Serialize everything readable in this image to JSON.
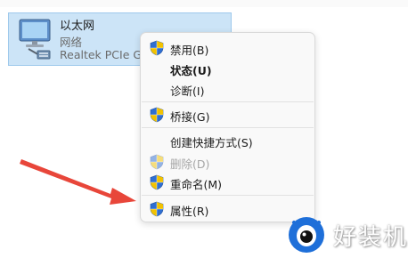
{
  "adapter": {
    "name": "以太网",
    "type": "网络",
    "device": "Realtek PCIe GbE Family Controller",
    "icon": "network-adapter-icon"
  },
  "context_menu": {
    "items": [
      {
        "label": "禁用(B)",
        "icon": "uac-shield-icon",
        "bold": false,
        "disabled": false
      },
      {
        "label": "状态(U)",
        "icon": null,
        "bold": true,
        "disabled": false
      },
      {
        "label": "诊断(I)",
        "icon": null,
        "bold": false,
        "disabled": false
      },
      {
        "label": "桥接(G)",
        "icon": "uac-shield-icon",
        "bold": false,
        "disabled": false
      },
      {
        "label": "创建快捷方式(S)",
        "icon": null,
        "bold": false,
        "disabled": false
      },
      {
        "label": "删除(D)",
        "icon": "uac-shield-icon",
        "bold": false,
        "disabled": true
      },
      {
        "label": "重命名(M)",
        "icon": "uac-shield-icon",
        "bold": false,
        "disabled": false
      },
      {
        "label": "属性(R)",
        "icon": "uac-shield-icon",
        "bold": false,
        "disabled": false
      }
    ]
  },
  "annotation": {
    "arrow_color": "#e8463a",
    "arrow_target": "属性(R)"
  },
  "watermark": {
    "text": "好装机",
    "logo": "eye-logo-icon",
    "accent": "#1e6fd9"
  },
  "colors": {
    "selection": "#cce4f7",
    "menu_bg": "#f9f9f9",
    "shield_blue": "#2f6fd3",
    "shield_yellow": "#f2c200"
  }
}
